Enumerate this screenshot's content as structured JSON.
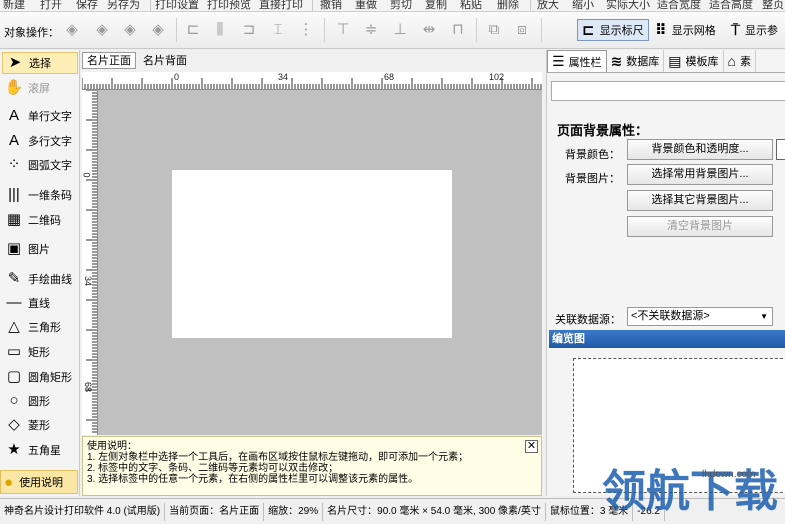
{
  "menubar": {
    "items": [
      "新建",
      "打开",
      "保存",
      "另存为",
      "打印设置",
      "打印预览",
      "直接打印",
      "撤销",
      "重做",
      "剪切",
      "复制",
      "粘贴",
      "删除",
      "放大",
      "缩小",
      "实际大小",
      "适合宽度",
      "适合高度",
      "整页"
    ]
  },
  "toolbar": {
    "object_ops_label": "对象操作：",
    "show_ruler_label": "显示标尺",
    "show_grid_label": "显示网格",
    "show_params_label": "显示参"
  },
  "tools": [
    {
      "name": "tool-select",
      "label": "选择",
      "icon": "arrow-icon",
      "glyph": "➤",
      "state": "selected"
    },
    {
      "name": "tool-scroll",
      "label": "滚屏",
      "icon": "hand-icon",
      "glyph": "✋",
      "state": "disabled"
    },
    {
      "name": "tool-single-text",
      "label": "单行文字",
      "icon": "single-text-icon",
      "glyph": "A",
      "state": "normal"
    },
    {
      "name": "tool-multi-text",
      "label": "多行文字",
      "icon": "multi-text-icon",
      "glyph": "A",
      "state": "normal"
    },
    {
      "name": "tool-arc-text",
      "label": "圆弧文字",
      "icon": "arc-text-icon",
      "glyph": "⁘",
      "state": "normal"
    },
    {
      "name": "tool-barcode",
      "label": "一维条码",
      "icon": "barcode-icon",
      "glyph": "|||",
      "state": "normal"
    },
    {
      "name": "tool-qrcode",
      "label": "二维码",
      "icon": "qrcode-icon",
      "glyph": "▦",
      "state": "normal"
    },
    {
      "name": "tool-image",
      "label": "图片",
      "icon": "image-icon",
      "glyph": "▣",
      "state": "normal"
    },
    {
      "name": "tool-freehand",
      "label": "手绘曲线",
      "icon": "pen-icon",
      "glyph": "✎",
      "state": "normal"
    },
    {
      "name": "tool-line",
      "label": "直线",
      "icon": "line-icon",
      "glyph": "—",
      "state": "normal"
    },
    {
      "name": "tool-triangle",
      "label": "三角形",
      "icon": "triangle-icon",
      "glyph": "△",
      "state": "normal"
    },
    {
      "name": "tool-rectangle",
      "label": "矩形",
      "icon": "rectangle-icon",
      "glyph": "▭",
      "state": "normal"
    },
    {
      "name": "tool-rounded-rect",
      "label": "圆角矩形",
      "icon": "rounded-rect-icon",
      "glyph": "▢",
      "state": "normal"
    },
    {
      "name": "tool-circle",
      "label": "圆形",
      "icon": "circle-icon",
      "glyph": "○",
      "state": "normal"
    },
    {
      "name": "tool-diamond",
      "label": "菱形",
      "icon": "diamond-icon",
      "glyph": "◇",
      "state": "normal"
    },
    {
      "name": "tool-star",
      "label": "五角星",
      "icon": "star-icon",
      "glyph": "★",
      "state": "normal"
    }
  ],
  "help_button": {
    "label": "使用说明"
  },
  "canvas": {
    "tabs": [
      "名片正面",
      "名片背面"
    ],
    "ruler_h": [
      "0",
      "34",
      "68",
      "102"
    ],
    "ruler_v": [
      "0",
      "34",
      "68"
    ]
  },
  "helpbox": {
    "title": "使用说明：",
    "lines": [
      "1. 左侧对象栏中选择一个工具后，在画布区域按住鼠标左键拖动，即可添加一个元素；",
      "2. 标签中的文字、条码、二维码等元素均可以双击修改；",
      "3. 选择标签中的任意一个元素，在右侧的属性栏里可以调整该元素的属性。"
    ],
    "close": "✕"
  },
  "rpanel": {
    "tabs": [
      {
        "label": "属性栏",
        "icon": "list-icon"
      },
      {
        "label": "数据库",
        "icon": "database-icon"
      },
      {
        "label": "模板库",
        "icon": "template-icon"
      },
      {
        "label": "素",
        "icon": "material-icon"
      }
    ],
    "title": "页面背景属性：",
    "bg_color_label": "背景颜色：",
    "bg_color_button": "背景颜色和透明度...",
    "bg_image_label": "背景图片：",
    "bg_common_button": "选择常用背景图片...",
    "bg_other_button": "选择其它背景图片...",
    "bg_clear_button": "清空背景图片",
    "assoc_label": "关联数据源：",
    "assoc_value": "<不关联数据源>",
    "preview_title": "编览图"
  },
  "status": {
    "app": "神奇名片设计打印软件 4.0 (试用版)",
    "page": "当前页面：名片正面",
    "zoom": "缩放：29%",
    "size": "名片尺寸：90.0 毫米 × 54.0 毫米, 300 像素/英寸",
    "coords": "鼠标位置：",
    "coord_value": "3 毫米",
    "extra": "-26.2"
  },
  "watermark": {
    "text": "领航下载",
    "site": "lhdown.com"
  }
}
